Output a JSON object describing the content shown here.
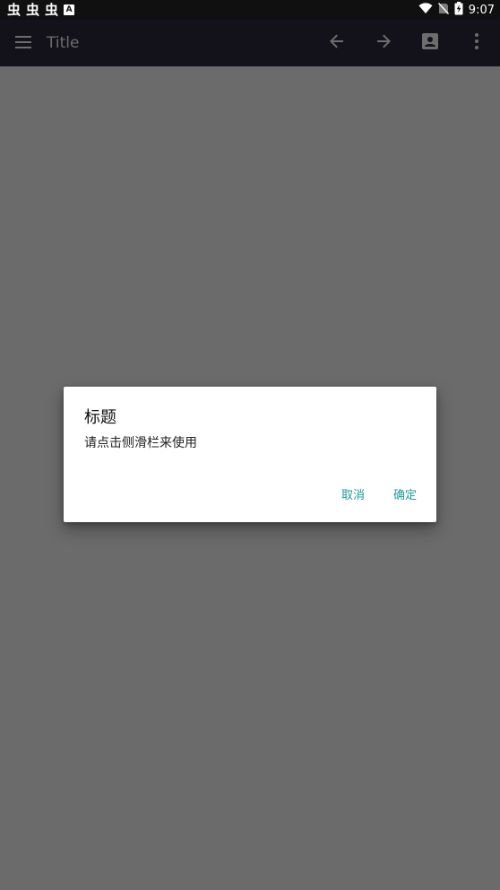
{
  "status_bar": {
    "left_glyphs": [
      "虫",
      "虫",
      "虫"
    ],
    "notification_icon_text": "A",
    "time": "9:07",
    "icons": [
      "wifi-icon",
      "no-sim-icon",
      "battery-charging-icon"
    ]
  },
  "app_bar": {
    "title": "Title",
    "icons": [
      "menu-icon",
      "arrow-back-icon",
      "arrow-forward-icon",
      "account-box-icon",
      "more-vert-icon"
    ]
  },
  "dialog": {
    "title": "标题",
    "message": "请点击侧滑栏来使用",
    "cancel_label": "取消",
    "confirm_label": "确定"
  },
  "colors": {
    "status_bar_bg": "#101010",
    "app_bar_bg": "#13121a",
    "overlay": "#6b6b6b",
    "dialog_bg": "#ffffff",
    "accent": "#1e9a9a"
  }
}
